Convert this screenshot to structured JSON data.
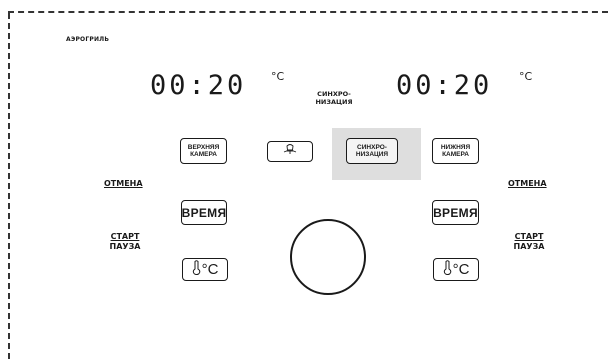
{
  "brand_label": "АЭРОГРИЛЬ",
  "left_zone": {
    "display_time": "00:20",
    "unit": "°C",
    "upper_chamber_label": "ВЕРХНЯЯ\nКАМЕРА",
    "cancel_label": "ОТМЕНА",
    "time_label": "ВРЕМЯ",
    "start_label": "СТАРТ",
    "pause_label": "ПАУЗА",
    "temp_label": "°C"
  },
  "right_zone": {
    "display_time": "00:20",
    "unit": "°C",
    "lower_chamber_label": "НИЖНЯЯ\nКАМЕРА",
    "cancel_label": "ОТМЕНА",
    "time_label": "ВРЕМЯ",
    "start_label": "СТАРТ",
    "pause_label": "ПАУЗА",
    "temp_label": "°C"
  },
  "center": {
    "sync_caption": "СИНХРО-\nНИЗАЦИЯ",
    "sync_button_label": "СИНХРО-\nНИЗАЦИЯ",
    "light_icon": "light-bulb-icon",
    "knob_icon": "dial-knob"
  },
  "colors": {
    "ink": "#1a1a1a",
    "highlight": "#dedede",
    "frame": "#333333"
  }
}
